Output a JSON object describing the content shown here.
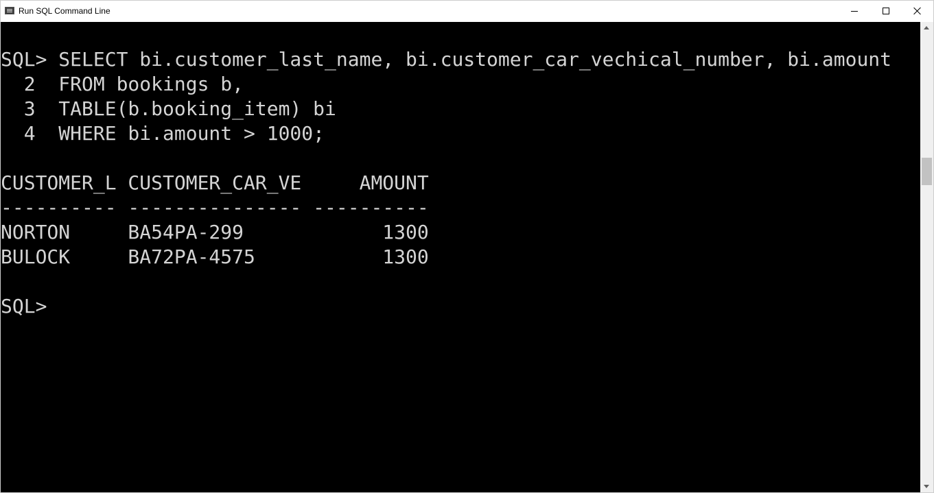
{
  "window": {
    "title": "Run SQL Command Line"
  },
  "console": {
    "lines": [
      "SQL> SELECT bi.customer_last_name, bi.customer_car_vechical_number, bi.amount",
      "  2  FROM bookings b,",
      "  3  TABLE(b.booking_item) bi",
      "  4  WHERE bi.amount > 1000;",
      "",
      "CUSTOMER_L CUSTOMER_CAR_VE     AMOUNT",
      "---------- --------------- ----------",
      "NORTON     BA54PA-299            1300",
      "BULOCK     BA72PA-4575           1300",
      "",
      "SQL>"
    ]
  },
  "query": {
    "columns": [
      "customer_last_name",
      "customer_car_vechical_number",
      "amount"
    ],
    "table": "bookings",
    "collection": "booking_item",
    "condition": "bi.amount > 1000"
  },
  "results": {
    "headers": [
      "CUSTOMER_L",
      "CUSTOMER_CAR_VE",
      "AMOUNT"
    ],
    "rows": [
      [
        "NORTON",
        "BA54PA-299",
        "1300"
      ],
      [
        "BULOCK",
        "BA72PA-4575",
        "1300"
      ]
    ]
  },
  "colors": {
    "console_background": "#000000",
    "console_text": "#d4d4d4",
    "titlebar_background": "#ffffff"
  }
}
